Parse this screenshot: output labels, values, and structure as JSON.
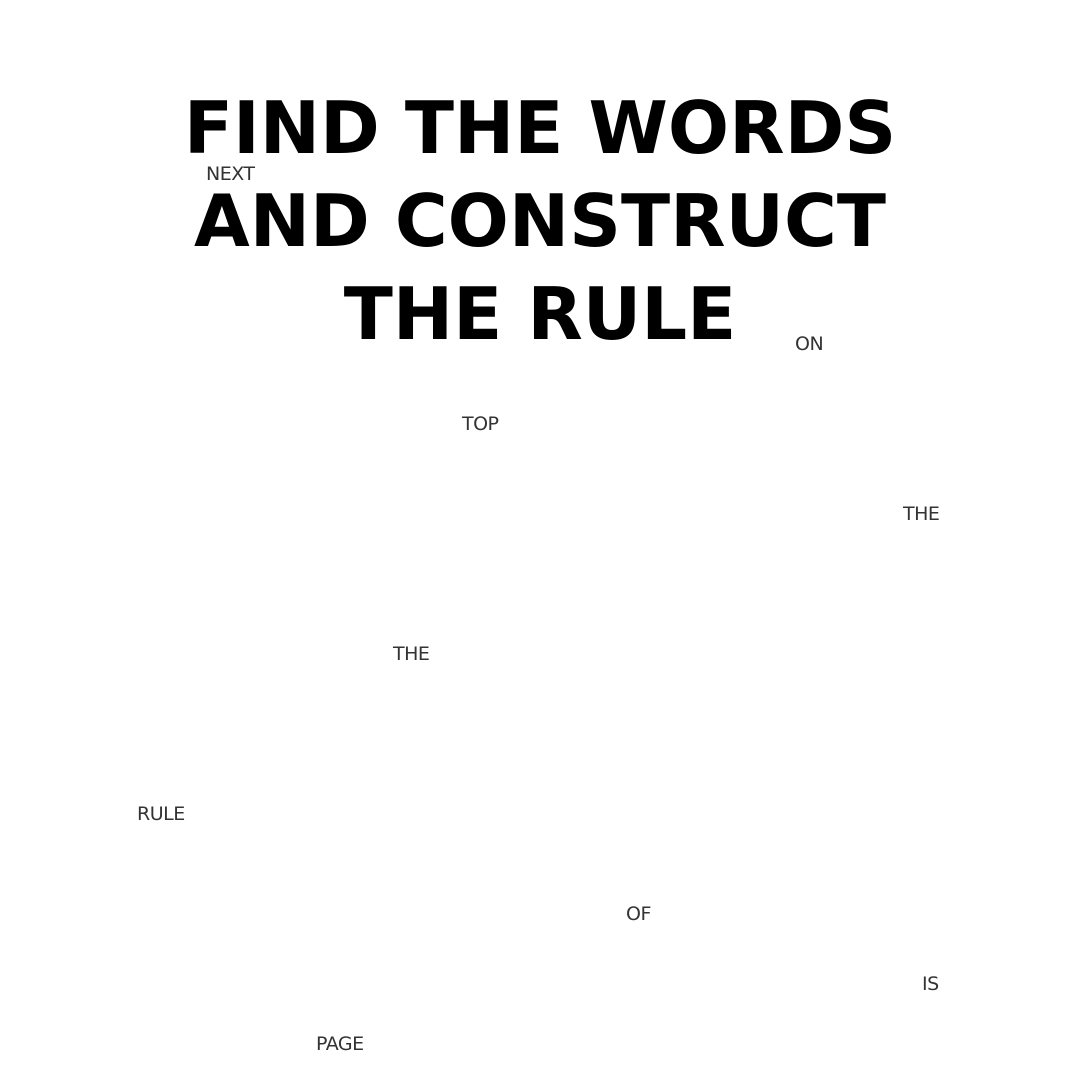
{
  "headline": {
    "line1": "FIND THE WORDS",
    "line2": "AND CONSTRUCT",
    "line3": "THE RULE"
  },
  "words": [
    "NEXT",
    "ON",
    "TOP",
    "THE",
    "THE",
    "RULE",
    "OF",
    "IS",
    "PAGE"
  ],
  "colors": {
    "background": "#ffffff",
    "headline": "#000000",
    "word": "#333333"
  }
}
